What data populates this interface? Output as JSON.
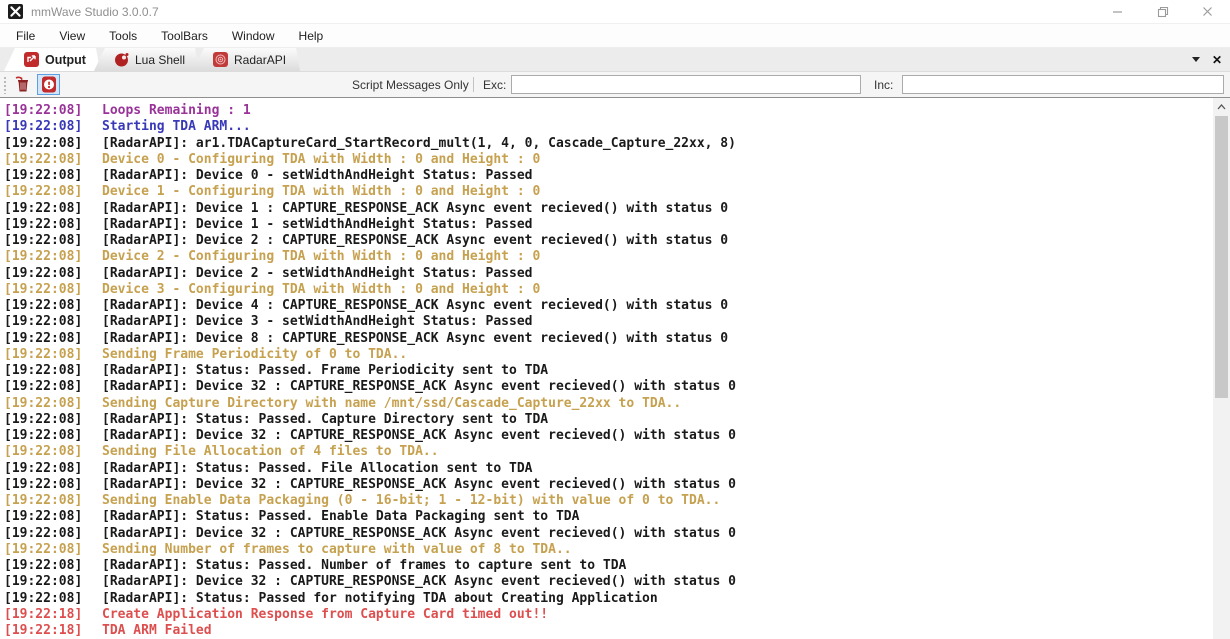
{
  "window": {
    "title": "mmWave Studio 3.0.0.7",
    "controls": {
      "minimize_icon": "minimize-icon",
      "maximize_icon": "restore-icon",
      "close_icon": "close-icon"
    }
  },
  "menu": {
    "items": [
      "File",
      "View",
      "Tools",
      "ToolBars",
      "Window",
      "Help"
    ]
  },
  "tabs": [
    {
      "label": "Output",
      "icon": "output-export-icon",
      "active": true
    },
    {
      "label": "Lua Shell",
      "icon": "lua-shell-icon",
      "active": false
    },
    {
      "label": "RadarAPI",
      "icon": "radar-api-icon",
      "active": false
    }
  ],
  "toolbar": {
    "clear_button_icon": "trash-icon",
    "messages_toggle_icon": "exclamation-circle-icon",
    "filter_label": "Script Messages Only",
    "exc_label": "Exc:",
    "exc_value": "",
    "inc_label": "Inc:",
    "inc_value": ""
  },
  "palette": {
    "purple": "#993399",
    "blue": "#3939B8",
    "black": "#1A1A1A",
    "orange": "#C6A14F",
    "red": "#DD4F4F",
    "toggle_selected_border": "#5E9FE0",
    "toggle_selected_bg": "#D3E6F9",
    "tab_icon_red": "#C22B2B"
  },
  "log": {
    "lines": [
      {
        "time": "[19:22:08]",
        "text": "Loops Remaining : 1",
        "color": "purple"
      },
      {
        "time": "[19:22:08]",
        "text": "Starting TDA ARM...",
        "color": "blue"
      },
      {
        "time": "[19:22:08]",
        "text": "[RadarAPI]: ar1.TDACaptureCard_StartRecord_mult(1, 4, 0, Cascade_Capture_22xx, 8)",
        "color": "black"
      },
      {
        "time": "[19:22:08]",
        "text": "Device 0 - Configuring TDA with Width : 0 and Height : 0",
        "color": "orange"
      },
      {
        "time": "[19:22:08]",
        "text": "[RadarAPI]: Device 0 - setWidthAndHeight Status: Passed",
        "color": "black"
      },
      {
        "time": "[19:22:08]",
        "text": "Device 1 - Configuring TDA with Width : 0 and Height : 0",
        "color": "orange"
      },
      {
        "time": "[19:22:08]",
        "text": "[RadarAPI]: Device 1 : CAPTURE_RESPONSE_ACK Async event recieved() with status 0",
        "color": "black"
      },
      {
        "time": "[19:22:08]",
        "text": "[RadarAPI]: Device 1 - setWidthAndHeight Status: Passed",
        "color": "black"
      },
      {
        "time": "[19:22:08]",
        "text": "[RadarAPI]: Device 2 : CAPTURE_RESPONSE_ACK Async event recieved() with status 0",
        "color": "black"
      },
      {
        "time": "[19:22:08]",
        "text": "Device 2 - Configuring TDA with Width : 0 and Height : 0",
        "color": "orange"
      },
      {
        "time": "[19:22:08]",
        "text": "[RadarAPI]: Device 2 - setWidthAndHeight Status: Passed",
        "color": "black"
      },
      {
        "time": "[19:22:08]",
        "text": "Device 3 - Configuring TDA with Width : 0 and Height : 0",
        "color": "orange"
      },
      {
        "time": "[19:22:08]",
        "text": "[RadarAPI]: Device 4 : CAPTURE_RESPONSE_ACK Async event recieved() with status 0",
        "color": "black"
      },
      {
        "time": "[19:22:08]",
        "text": "[RadarAPI]: Device 3 - setWidthAndHeight Status: Passed",
        "color": "black"
      },
      {
        "time": "[19:22:08]",
        "text": "[RadarAPI]: Device 8 : CAPTURE_RESPONSE_ACK Async event recieved() with status 0",
        "color": "black"
      },
      {
        "time": "[19:22:08]",
        "text": "Sending Frame Periodicity of 0 to TDA..",
        "color": "orange"
      },
      {
        "time": "[19:22:08]",
        "text": "[RadarAPI]: Status: Passed. Frame Periodicity sent to TDA",
        "color": "black"
      },
      {
        "time": "[19:22:08]",
        "text": "[RadarAPI]: Device 32 : CAPTURE_RESPONSE_ACK Async event recieved() with status 0",
        "color": "black"
      },
      {
        "time": "[19:22:08]",
        "text": "Sending Capture Directory with name /mnt/ssd/Cascade_Capture_22xx to TDA..",
        "color": "orange"
      },
      {
        "time": "[19:22:08]",
        "text": "[RadarAPI]: Status: Passed. Capture Directory sent to TDA",
        "color": "black"
      },
      {
        "time": "[19:22:08]",
        "text": "[RadarAPI]: Device 32 : CAPTURE_RESPONSE_ACK Async event recieved() with status 0",
        "color": "black"
      },
      {
        "time": "[19:22:08]",
        "text": "Sending File Allocation of 4 files to TDA..",
        "color": "orange"
      },
      {
        "time": "[19:22:08]",
        "text": "[RadarAPI]: Status: Passed. File Allocation sent to TDA",
        "color": "black"
      },
      {
        "time": "[19:22:08]",
        "text": "[RadarAPI]: Device 32 : CAPTURE_RESPONSE_ACK Async event recieved() with status 0",
        "color": "black"
      },
      {
        "time": "[19:22:08]",
        "text": "Sending Enable Data Packaging (0 - 16-bit; 1 - 12-bit) with value of 0 to TDA..",
        "color": "orange"
      },
      {
        "time": "[19:22:08]",
        "text": "[RadarAPI]: Status: Passed. Enable Data Packaging sent to TDA",
        "color": "black"
      },
      {
        "time": "[19:22:08]",
        "text": "[RadarAPI]: Device 32 : CAPTURE_RESPONSE_ACK Async event recieved() with status 0",
        "color": "black"
      },
      {
        "time": "[19:22:08]",
        "text": "Sending Number of frames to capture with value of 8 to TDA..",
        "color": "orange"
      },
      {
        "time": "[19:22:08]",
        "text": "[RadarAPI]: Status: Passed. Number of frames to capture sent to TDA",
        "color": "black"
      },
      {
        "time": "[19:22:08]",
        "text": "[RadarAPI]: Device 32 : CAPTURE_RESPONSE_ACK Async event recieved() with status 0",
        "color": "black"
      },
      {
        "time": "[19:22:08]",
        "text": "[RadarAPI]: Status: Passed for notifying TDA about Creating Application",
        "color": "black"
      },
      {
        "time": "[19:22:18]",
        "text": "Create Application Response from Capture Card timed out!!",
        "color": "red"
      },
      {
        "time": "[19:22:18]",
        "text": "TDA ARM Failed",
        "color": "red"
      }
    ]
  }
}
